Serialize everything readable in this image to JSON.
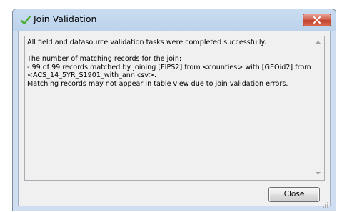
{
  "window": {
    "title": "Join Validation",
    "close_glyph": "×",
    "icon": "check-icon",
    "colors": {
      "check": "#4caf33",
      "close_button": "#c8452f"
    }
  },
  "message": {
    "lines": [
      "All field and datasource validation tasks were completed successfully.",
      "",
      "The number of matching records for the join:",
      "- 99 of 99 records matched by joining [FIPS2] from <counties> with [GEOid2] from",
      "<ACS_14_5YR_S1901_with_ann.csv>.",
      "Matching records may not appear in table view due to join validation errors."
    ]
  },
  "buttons": {
    "close_label": "Close"
  }
}
